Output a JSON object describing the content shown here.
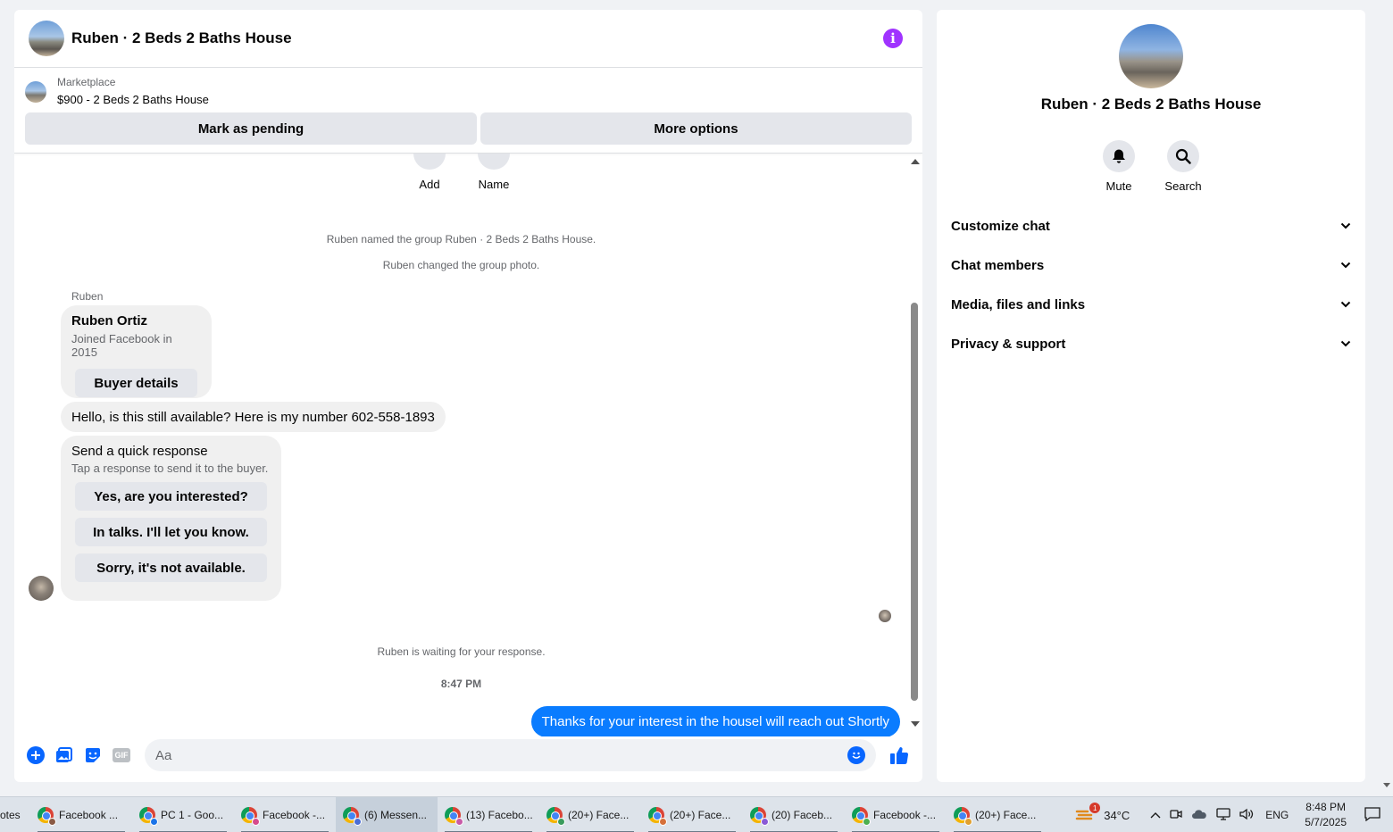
{
  "header": {
    "title": "Ruben · 2 Beds 2 Baths House"
  },
  "listing": {
    "label": "Marketplace",
    "item": "$900 - 2 Beds 2 Baths House",
    "mark_pending": "Mark as pending",
    "more_options": "More options"
  },
  "mini_actions": {
    "add": "Add",
    "name": "Name"
  },
  "messages": {
    "sys_named": "Ruben named the group Ruben · 2 Beds 2 Baths House.",
    "sys_photo": "Ruben changed the group photo.",
    "sender": "Ruben",
    "profile_name": "Ruben Ortiz",
    "profile_sub": "Joined Facebook in 2015",
    "buyer_details": "Buyer details",
    "incoming_text": "Hello, is this still available? Here is my number 602-558-1893",
    "quick_title": "Send a quick response",
    "quick_sub": "Tap a response to send it to the buyer.",
    "quick_options": [
      "Yes, are you interested?",
      "In talks. I'll let you know.",
      "Sorry, it's not available."
    ],
    "waiting": "Ruben is waiting for your response.",
    "time": "8:47 PM",
    "outgoing_text": "Thanks for your interest in the housel will reach out Shortly"
  },
  "composer": {
    "placeholder": "Aa",
    "gif_label": "GIF"
  },
  "info_panel": {
    "title": "Ruben · 2 Beds 2 Baths House",
    "mute": "Mute",
    "search": "Search",
    "sections": [
      "Customize chat",
      "Chat members",
      "Media, files and links",
      "Privacy & support"
    ]
  },
  "taskbar": {
    "items": [
      {
        "label": "otes",
        "state": "running"
      },
      {
        "label": "Facebook ...",
        "state": "running",
        "badge": "#8a5a44"
      },
      {
        "label": "PC 1 - Goo...",
        "state": "running",
        "badge": "#1a73e8"
      },
      {
        "label": "Facebook -...",
        "state": "running",
        "badge": "#d64b8c"
      },
      {
        "label": "(6) Messen...",
        "state": "active",
        "badge": "#4a6ed6"
      },
      {
        "label": "(13) Facebo...",
        "state": "running",
        "badge": "#c85aa8"
      },
      {
        "label": "(20+) Face...",
        "state": "running",
        "badge": "#3a9b5c"
      },
      {
        "label": "(20+) Face...",
        "state": "running",
        "badge": "#d6703a"
      },
      {
        "label": "(20) Faceb...",
        "state": "running",
        "badge": "#8a5ad6"
      },
      {
        "label": "Facebook -...",
        "state": "running",
        "badge": "#4caf50"
      },
      {
        "label": "(20+) Face...",
        "state": "running",
        "badge": "#e0a030"
      }
    ],
    "weather_badge": "1",
    "temperature": "34°C",
    "language": "ENG",
    "time": "8:48 PM",
    "date": "5/7/2025"
  },
  "colors": {
    "accent": "#0866ff",
    "outgoing_bubble": "#0a7cff",
    "info_icon": "#a033ff"
  }
}
